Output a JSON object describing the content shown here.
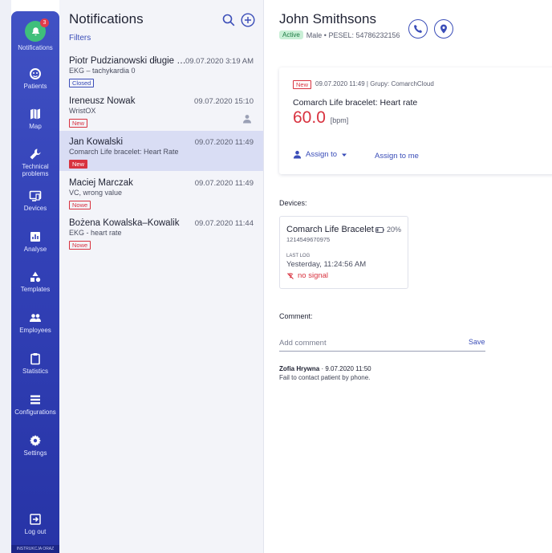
{
  "sidebar": {
    "notification_count": "3",
    "items": [
      {
        "label": "Notifications",
        "icon": "bell-icon"
      },
      {
        "label": "Patients",
        "icon": "patients-icon"
      },
      {
        "label": "Map",
        "icon": "map-icon"
      },
      {
        "label": "Technical problems",
        "icon": "wrench-icon"
      },
      {
        "label": "Devices",
        "icon": "devices-icon"
      },
      {
        "label": "Analyse",
        "icon": "analyse-icon"
      },
      {
        "label": "Templates",
        "icon": "templates-icon"
      },
      {
        "label": "Employees",
        "icon": "employees-icon"
      },
      {
        "label": "Statistics",
        "icon": "clipboard-icon"
      },
      {
        "label": "Configurations",
        "icon": "list-icon"
      },
      {
        "label": "Settings",
        "icon": "gear-icon"
      }
    ],
    "logout_label": "Log out",
    "footer_text": "INSTRUKCJA ORAZ"
  },
  "list": {
    "title": "Notifications",
    "filters_label": "Filters",
    "items": [
      {
        "name": "Piotr Pudzianowski długie n...",
        "desc": "EKG – tachykardia 0",
        "time": "09.07.2020 3:19 AM",
        "tag": "Closed"
      },
      {
        "name": "Ireneusz Nowak",
        "desc": "WristOX",
        "time": "09.07.2020 15:10",
        "tag": "New"
      },
      {
        "name": "Jan Kowalski",
        "desc": "Comarch Life bracelet: Heart Rate",
        "time": "09.07.2020 11:49",
        "tag": "New"
      },
      {
        "name": "Maciej Marczak",
        "desc": "VC, wrong value",
        "time": "09.07.2020 11:49",
        "tag": "Nowe"
      },
      {
        "name": "Bożena Kowalska–Kowalik",
        "desc": "EKG - heart rate",
        "time": "09.07.2020 11:44",
        "tag": "Nowe"
      }
    ]
  },
  "patient": {
    "name": "John Smithsons",
    "status": "Active",
    "meta": "Male • PESEL: 54786232156"
  },
  "alert": {
    "tag": "New",
    "meta": "09.07.2020 11:49  |  Grupy: ComarchCloud",
    "title": "Comarch Life bracelet: Heart rate",
    "value": "60.0",
    "unit": "[bpm]",
    "assign_to_label": "Assign to",
    "assign_me_label": "Assign to me"
  },
  "devices": {
    "section_label": "Devices:",
    "device": {
      "name": "Comarch Life Bracelet",
      "battery": "20%",
      "serial": "1214549670975",
      "last_log_label": "LAST LOG",
      "last_log_value": "Yesterday, 11:24:56 AM",
      "signal": "no signal"
    }
  },
  "comments": {
    "section_label": "Comment:",
    "placeholder": "Add comment",
    "save_label": "Save",
    "author": "Zofia Hrywna",
    "date": "· 9.07.2020 11:50",
    "text": "Fail to contact patient by phone."
  },
  "colors": {
    "accent": "#3a4db8",
    "alert": "#d8323f",
    "active_green": "#3fbf7b"
  }
}
